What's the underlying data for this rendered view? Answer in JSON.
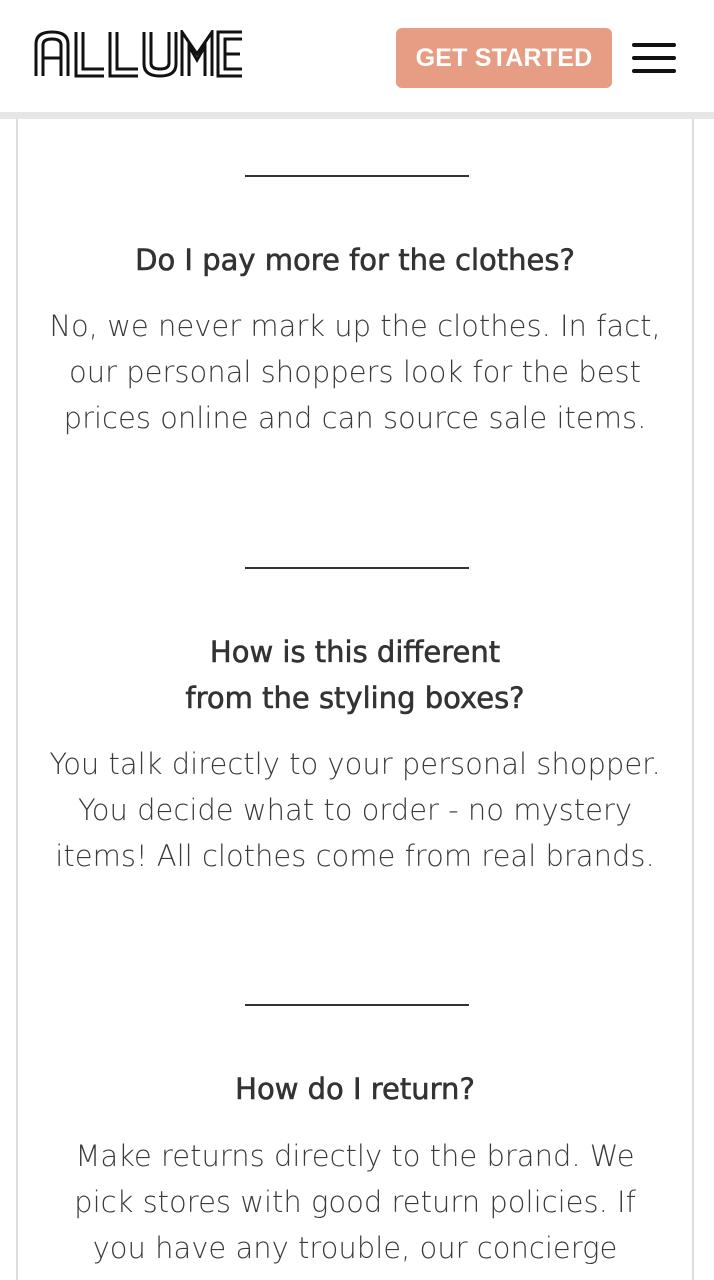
{
  "header": {
    "logo_text": "ALLUME",
    "cta_label": "GET STARTED",
    "menu_icon": "hamburger-menu-icon"
  },
  "colors": {
    "accent": "#e69d83",
    "text": "#333333",
    "background": "#ffffff"
  },
  "faq": [
    {
      "question": "Do I pay more for the clothes?",
      "answer": "No, we never mark up the clothes. In fact, our personal shoppers look for the best prices online and can source sale items."
    },
    {
      "question_line1": "How is this different",
      "question_line2": "from the styling boxes?",
      "answer": "You talk directly to your personal shopper. You decide what to order - no mystery items! All clothes come from real brands."
    },
    {
      "question": "How do I return?",
      "answer": "Make returns directly to the brand. We pick stores with good return policies. If you have any trouble, our concierge"
    }
  ]
}
